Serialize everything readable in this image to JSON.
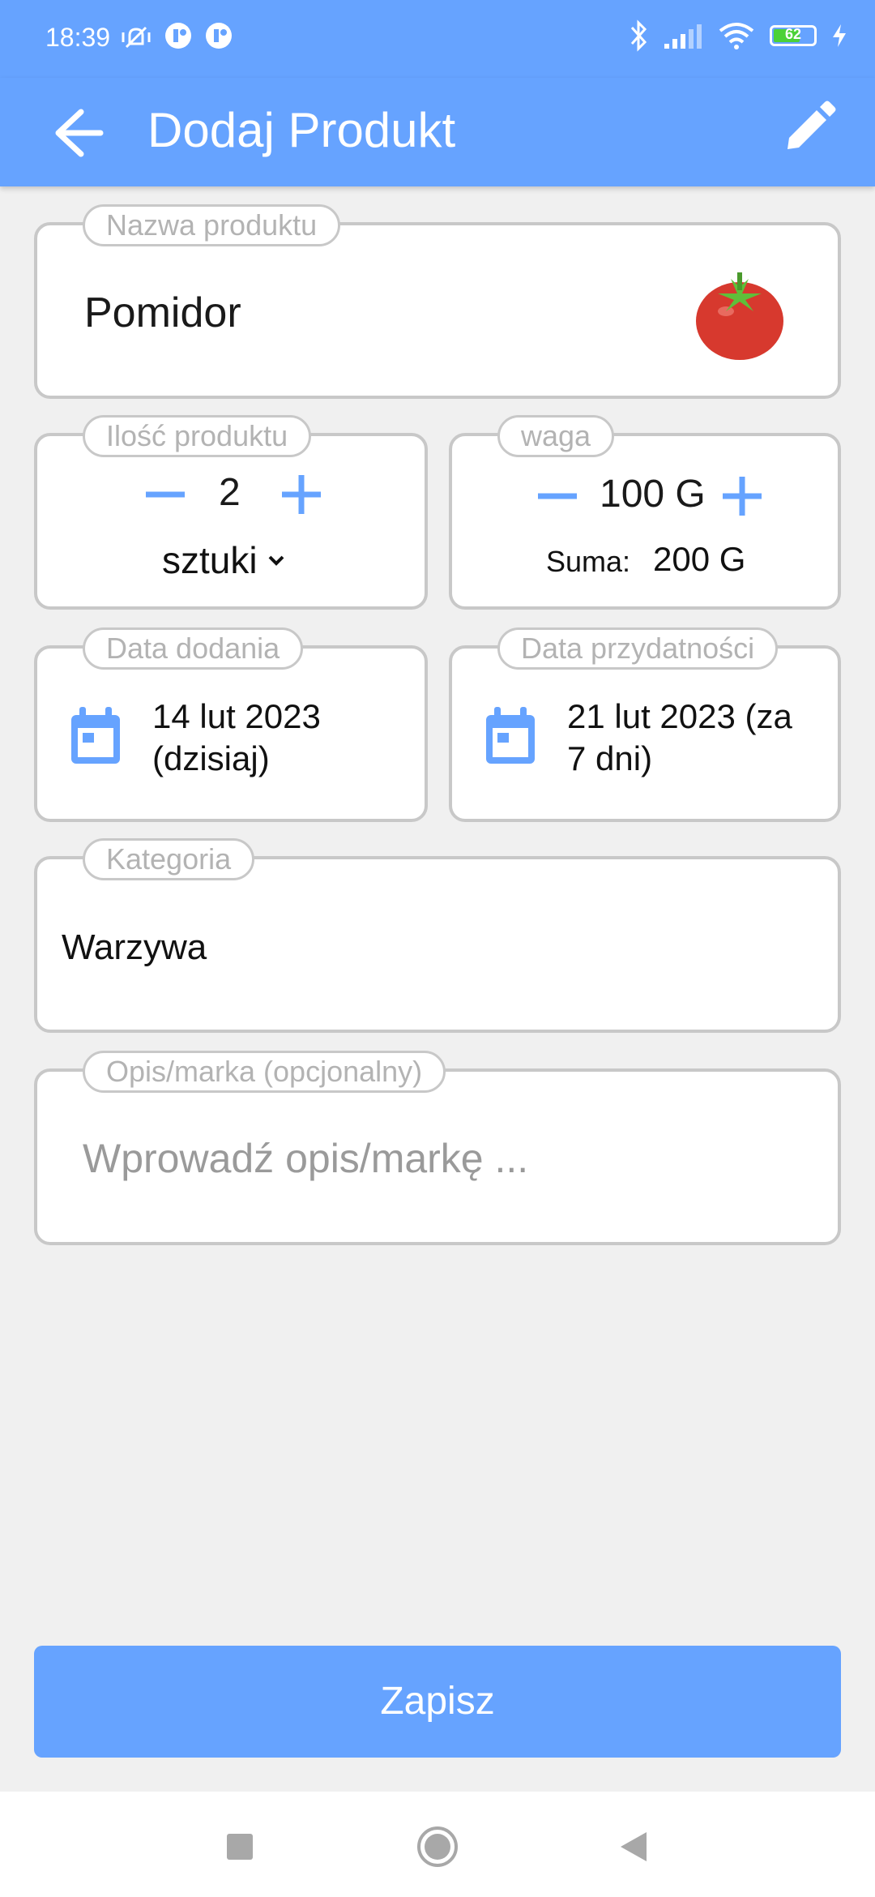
{
  "status_bar": {
    "time": "18:39",
    "battery_level": "62",
    "left_icons": [
      "mute-vibrate-icon",
      "app-notification-icon",
      "app-notification-icon"
    ],
    "right_icons": [
      "bluetooth-icon",
      "signal-icon",
      "wifi-icon",
      "battery-icon",
      "charging-icon"
    ]
  },
  "app_bar": {
    "title": "Dodaj Produkt",
    "back_icon": "arrow-back-icon",
    "edit_icon": "pencil-icon"
  },
  "product_name": {
    "label": "Nazwa produktu",
    "value": "Pomidor",
    "icon": "tomato-icon"
  },
  "quantity": {
    "label": "Ilość produktu",
    "value": "2",
    "unit": "sztuki"
  },
  "weight": {
    "label": "waga",
    "value": "100 G",
    "sum_label": "Suma:",
    "sum_value": "200 G"
  },
  "date_added": {
    "label": "Data dodania",
    "line1": "14 lut 2023",
    "line2": "(dzisiaj)"
  },
  "expiry_date": {
    "label": "Data przydatności",
    "line1": "21 lut 2023 (za",
    "line2": "7 dni)"
  },
  "category": {
    "label": "Kategoria",
    "value": "Warzywa"
  },
  "description": {
    "label": "Opis/marka (opcjonalny)",
    "placeholder": "Wprowadź opis/markę ..."
  },
  "save_button": {
    "label": "Zapisz"
  },
  "colors": {
    "accent": "#66a3ff",
    "border": "#c8c8c8",
    "background": "#f0f0f0"
  }
}
